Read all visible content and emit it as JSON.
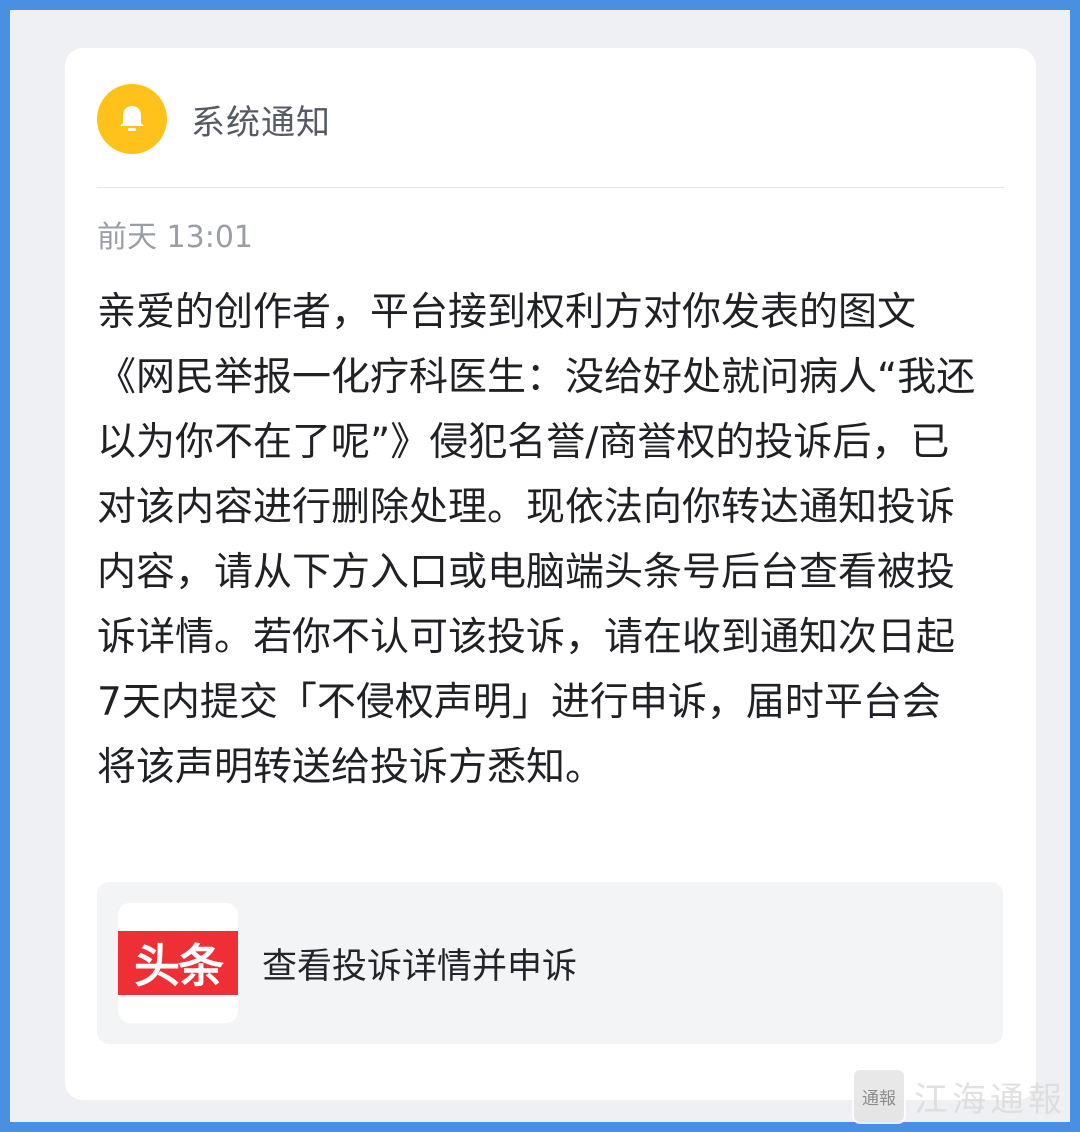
{
  "header": {
    "icon": "bell-icon",
    "title": "系统通知"
  },
  "timestamp": "前天 13:01",
  "message": "亲爱的创作者，平台接到权利方对你发表的图文《网民举报一化疗科医生：没给好处就问病人“我还以为你不在了呢”》侵犯名誉/商誉权的投诉后，已对该内容进行删除处理。现依法向你转达通知投诉内容，请从下方入口或电脑端头条号后台查看被投诉详情。若你不认可该投诉，请在收到通知次日起7天内提交「不侵权声明」进行申诉，届时平台会将该声明转送给投诉方悉知。",
  "action": {
    "app_logo_text": "头条",
    "label": "查看投诉详情并申诉"
  },
  "watermark": {
    "seal_text": "通報",
    "text": "江海通報"
  },
  "colors": {
    "frame": "#4a90e2",
    "bell": "#ffc21a",
    "logo_red": "#ee2f36"
  }
}
